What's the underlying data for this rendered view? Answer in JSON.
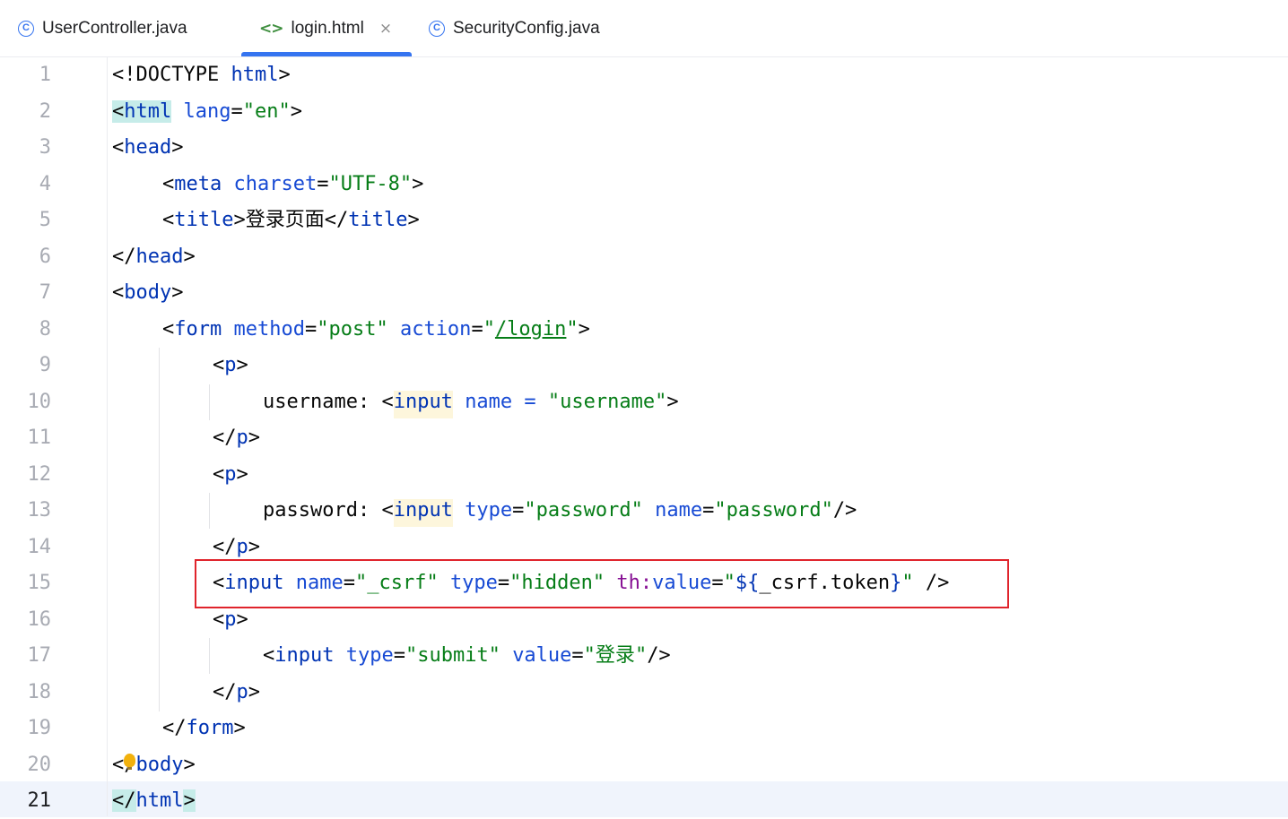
{
  "tabs": [
    {
      "label": "UserController.java",
      "icon": "java-class-icon",
      "active": false
    },
    {
      "label": "login.html",
      "icon": "html-file-icon",
      "active": true,
      "close": "×"
    },
    {
      "label": "SecurityConfig.java",
      "icon": "java-class-icon",
      "active": false
    }
  ],
  "gutter": {
    "line_numbers": [
      "1",
      "2",
      "3",
      "4",
      "5",
      "6",
      "7",
      "8",
      "9",
      "10",
      "11",
      "12",
      "13",
      "14",
      "15",
      "16",
      "17",
      "18",
      "19",
      "20",
      "21"
    ],
    "current_line": "21"
  },
  "code": {
    "l1": {
      "a": "<!DOCTYPE ",
      "b": "html",
      ">": ">"
    },
    "l2": {
      "lt": "<",
      "tag": "html",
      "attr": "lang",
      "eq": "=",
      "val": "\"en\"",
      "gt": ">"
    },
    "l3": {
      "lt": "<",
      "tag": "head",
      "gt": ">"
    },
    "l4": {
      "lt": "<",
      "tag": "meta",
      "attr": "charset",
      "eq": "=",
      "val": "\"UTF-8\"",
      "gt": ">"
    },
    "l5": {
      "lt": "<",
      "tag": "title",
      "gt": ">",
      "text": "登录页面",
      "lt2": "</",
      "tag2": "title",
      "gt2": ">"
    },
    "l6": {
      "lt": "</",
      "tag": "head",
      "gt": ">"
    },
    "l7": {
      "lt": "<",
      "tag": "body",
      "gt": ">"
    },
    "l8": {
      "lt": "<",
      "tag": "form",
      "attr1": "method",
      "eq1": "=",
      "val1": "\"post\"",
      "attr2": "action",
      "eq2": "=",
      "q1": "\"",
      "url": "/login",
      "q2": "\"",
      "gt": ">"
    },
    "l9": {
      "lt": "<",
      "tag": "p",
      "gt": ">"
    },
    "l10": {
      "text": "username: ",
      "lt": "<",
      "tag": "input",
      "attr": "name",
      "eq": " = ",
      "val": "\"username\"",
      "gt": ">"
    },
    "l11": {
      "lt": "</",
      "tag": "p",
      "gt": ">"
    },
    "l12": {
      "lt": "<",
      "tag": "p",
      "gt": ">"
    },
    "l13": {
      "text": "password: ",
      "lt": "<",
      "tag": "input",
      "attr1": "type",
      "eq1": "=",
      "val1": "\"password\"",
      "attr2": "name",
      "eq2": "=",
      "val2": "\"password\"",
      "gt": "/>"
    },
    "l14": {
      "lt": "</",
      "tag": "p",
      "gt": ">"
    },
    "l15": {
      "lt": "<",
      "tag": "input",
      "attr1": "name",
      "eq1": "=",
      "val1": "\"_csrf\"",
      "attr2": "type",
      "eq2": "=",
      "val2": "\"hidden\"",
      "attr3": "th:",
      "attr3b": "value",
      "eq3": "=",
      "q1": "\"",
      "expr_open": "${",
      "expr": "_csrf.token",
      "expr_close": "}",
      "q2": "\"",
      "gt": " />"
    },
    "l16": {
      "lt": "<",
      "tag": "p",
      "gt": ">"
    },
    "l17": {
      "lt": "<",
      "tag": "input",
      "attr1": "type",
      "eq1": "=",
      "val1": "\"submit\"",
      "attr2": "value",
      "eq2": "=",
      "q1": "\"",
      "cn": "登录",
      "q2": "\"",
      "gt": "/>"
    },
    "l18": {
      "lt": "</",
      "tag": "p",
      "gt": ">"
    },
    "l19": {
      "lt": "</",
      "tag": "form",
      "gt": ">"
    },
    "l20": {
      "lt": "</",
      "tag": "body",
      "gt": ">"
    },
    "l21": {
      "lt": "</",
      "tag": "html",
      "gt": ">"
    }
  },
  "colors": {
    "tag": "#0033b3",
    "attr": "#174ad4",
    "value": "#067d17",
    "thymeleaf": "#871094",
    "accent": "#3574f0",
    "highlight_box": "#e0242c"
  }
}
